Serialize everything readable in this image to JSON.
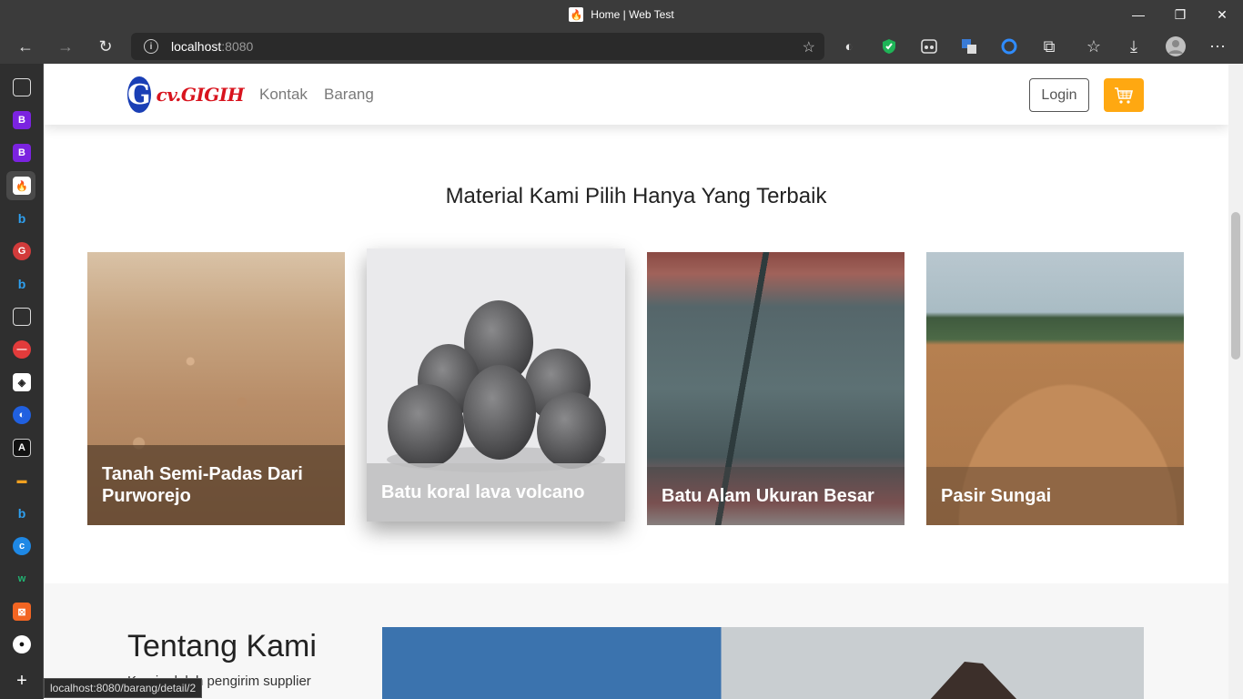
{
  "browser": {
    "tab_title": "Home | Web Test",
    "url_host": "localhost",
    "url_port": ":8080",
    "status_url": "localhost:8080/barang/detail/2"
  },
  "site": {
    "logo_letter": "G",
    "logo_text": "cv.GIGIH",
    "nav": {
      "kontak": "Kontak",
      "barang": "Barang"
    },
    "login_label": "Login",
    "section_title": "Material Kami Pilih Hanya Yang Terbaik",
    "products": [
      {
        "name": "Tanah Semi-Padas Dari Purworejo"
      },
      {
        "name": "Batu koral lava volcano"
      },
      {
        "name": "Batu Alam Ukuran Besar"
      },
      {
        "name": "Pasir Sungai"
      }
    ],
    "about": {
      "title": "Tentang Kami",
      "text": "Kami adalah pengirim supplier"
    }
  },
  "colors": {
    "accent": "#ffa811",
    "logo_blue": "#1a3fb5",
    "logo_red": "#d8141e"
  }
}
